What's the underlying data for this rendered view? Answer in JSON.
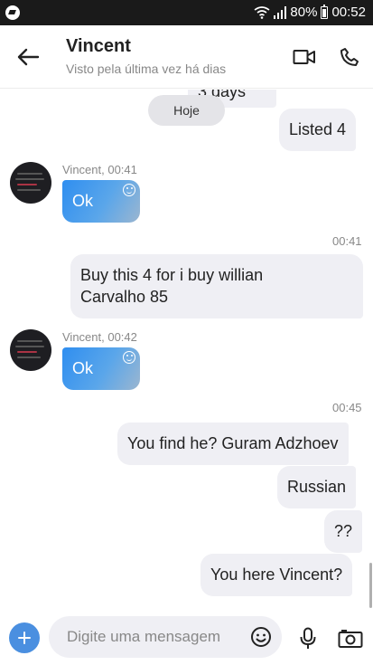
{
  "status_bar": {
    "battery": "80%",
    "time": "00:52",
    "icons": [
      "app-icon",
      "wifi-icon",
      "signal-icon",
      "battery-icon"
    ]
  },
  "header": {
    "title": "Vincent",
    "subtitle": "Visto pela última vez há dias",
    "icons": [
      "back-arrow-icon",
      "video-call-icon",
      "phone-icon"
    ]
  },
  "chat": {
    "partial_text": "3 days",
    "date_label": "Hoje",
    "messages": [
      {
        "direction": "out",
        "text": "Listed 4"
      },
      {
        "direction": "in",
        "sender": "Vincent, 00:41",
        "text": "Ok"
      },
      {
        "direction": "time",
        "text": "00:41"
      },
      {
        "direction": "out",
        "lines": [
          "Buy this 4 for i buy  willian",
          "Carvalho 85"
        ]
      },
      {
        "direction": "in",
        "sender": "Vincent, 00:42",
        "text": "Ok"
      },
      {
        "direction": "time",
        "text": "00:45"
      },
      {
        "direction": "out",
        "text": "You find he? Guram Adzhoev"
      },
      {
        "direction": "out",
        "text": "Russian"
      },
      {
        "direction": "out",
        "text": "??"
      },
      {
        "direction": "out",
        "text": "You here Vincent?"
      }
    ]
  },
  "composer": {
    "placeholder": "Digite uma mensagem",
    "icons": [
      "add-icon",
      "emoji-icon",
      "microphone-icon",
      "camera-icon"
    ]
  },
  "colors": {
    "incoming_start": "#2f8ef0",
    "incoming_end": "#9bb6d0",
    "outgoing_bubble": "#efeff4",
    "status_bar": "#1a1a1a"
  }
}
